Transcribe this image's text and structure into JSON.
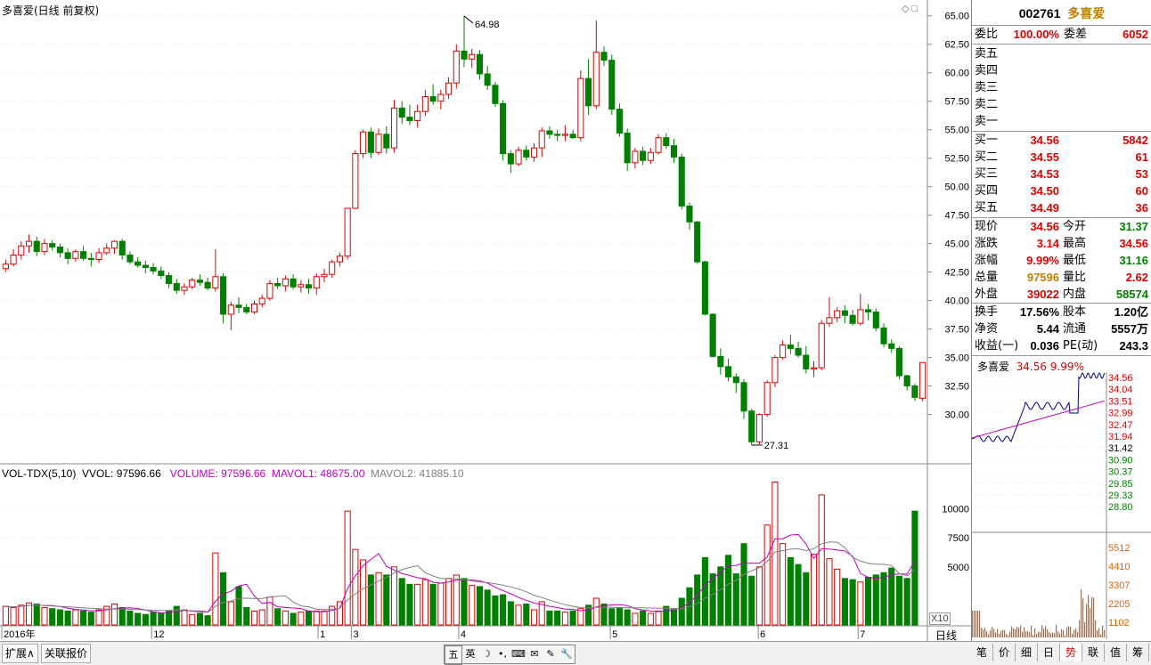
{
  "chart_title": "多喜爱(日线 前复权)",
  "price_axis_labels": [
    "65.00",
    "62.50",
    "60.00",
    "57.50",
    "55.00",
    "52.50",
    "50.00",
    "47.50",
    "45.00",
    "42.50",
    "40.00",
    "37.50",
    "35.00",
    "32.50",
    "30.00"
  ],
  "high_marker": "64.98",
  "low_marker": "27.31",
  "volume_legend": {
    "name": "VOL-TDX(5,10)",
    "vvol": "VVOL: 97596.66",
    "volume": "VOLUME: 97596.66",
    "mavol1": "MAVOL1: 48675.00",
    "mavol2": "MAVOL2: 41885.10"
  },
  "volume_axis_labels": [
    "10000",
    "7500",
    "5000"
  ],
  "volume_unit": "X10",
  "date_axis_labels": [
    "2016年",
    "12",
    "1",
    "3",
    "4",
    "5",
    "6",
    "7"
  ],
  "period_label": "日线",
  "bottom_tabs": [
    "扩展∧",
    "关联报价"
  ],
  "toolbar_icons": [
    "五",
    "英",
    "☽",
    "•,",
    "⌨",
    "✉",
    "✎",
    "🔧"
  ],
  "quote": {
    "code": "002761",
    "name": "多喜爱",
    "weibi_label": "委比",
    "weibi_value": "100.00%",
    "weicha_label": "委差",
    "weicha_value": "6052",
    "sell": [
      {
        "label": "卖五",
        "price": "",
        "vol": ""
      },
      {
        "label": "卖四",
        "price": "",
        "vol": ""
      },
      {
        "label": "卖三",
        "price": "",
        "vol": ""
      },
      {
        "label": "卖二",
        "price": "",
        "vol": ""
      },
      {
        "label": "卖一",
        "price": "",
        "vol": ""
      }
    ],
    "buy": [
      {
        "label": "买一",
        "price": "34.56",
        "vol": "5842"
      },
      {
        "label": "买二",
        "price": "34.55",
        "vol": "61"
      },
      {
        "label": "买三",
        "price": "34.53",
        "vol": "53"
      },
      {
        "label": "买四",
        "price": "34.50",
        "vol": "60"
      },
      {
        "label": "买五",
        "price": "34.49",
        "vol": "36"
      }
    ],
    "stats": [
      {
        "l1": "现价",
        "v1": "34.56",
        "c1": "red",
        "l2": "今开",
        "v2": "31.37",
        "c2": "green"
      },
      {
        "l1": "涨跌",
        "v1": "3.14",
        "c1": "red",
        "l2": "最高",
        "v2": "34.56",
        "c2": "red"
      },
      {
        "l1": "涨幅",
        "v1": "9.99%",
        "c1": "red",
        "l2": "最低",
        "v2": "31.16",
        "c2": "green"
      },
      {
        "l1": "总量",
        "v1": "97596",
        "c1": "olive",
        "l2": "量比",
        "v2": "2.62",
        "c2": "red"
      },
      {
        "l1": "外盘",
        "v1": "39022",
        "c1": "red",
        "l2": "内盘",
        "v2": "58574",
        "c2": "green"
      }
    ],
    "fin": [
      {
        "l1": "换手",
        "v1": "17.56%",
        "l2": "股本",
        "v2": "1.20亿"
      },
      {
        "l1": "净资",
        "v1": "5.44",
        "l2": "流通",
        "v2": "5557万"
      },
      {
        "l1": "收益(一)",
        "v1": "0.036",
        "l2": "PE(动)",
        "v2": "243.3"
      }
    ],
    "mini_title": "多喜爱",
    "mini_price": "34.56",
    "mini_pct": "9.99%",
    "mini_price_axis": [
      "34.56",
      "34.04",
      "33.51",
      "32.99",
      "32.47",
      "31.94",
      "31.42",
      "30.90",
      "30.37",
      "29.85",
      "29.33",
      "28.80"
    ],
    "mini_vol_axis": [
      "5512",
      "4410",
      "3307",
      "2205",
      "1102"
    ]
  },
  "right_tabs": [
    "笔",
    "价",
    "细",
    "日",
    "势",
    "联",
    "值",
    "筹"
  ],
  "colors": {
    "up": "#e00000",
    "down": "#008000",
    "ma1": "#c000c0",
    "ma2": "#808080"
  },
  "chart_data": {
    "type": "candlestick",
    "candles": [
      [
        42.8,
        43.6,
        42.5,
        43.2
      ],
      [
        43.2,
        44.5,
        43.0,
        44.0
      ],
      [
        44.0,
        45.2,
        43.6,
        44.8
      ],
      [
        44.8,
        45.8,
        44.2,
        45.2
      ],
      [
        45.2,
        45.6,
        43.9,
        44.3
      ],
      [
        44.3,
        45.4,
        44.0,
        45.0
      ],
      [
        45.0,
        45.3,
        44.4,
        44.7
      ],
      [
        44.7,
        45.0,
        43.8,
        44.2
      ],
      [
        44.2,
        44.6,
        43.2,
        43.7
      ],
      [
        43.7,
        44.5,
        43.4,
        44.3
      ],
      [
        44.3,
        44.8,
        43.5,
        43.7
      ],
      [
        43.7,
        44.2,
        43.0,
        43.6
      ],
      [
        43.6,
        44.6,
        43.3,
        44.2
      ],
      [
        44.2,
        45.0,
        44.0,
        44.6
      ],
      [
        44.6,
        45.3,
        44.1,
        45.2
      ],
      [
        45.2,
        45.4,
        43.6,
        44.0
      ],
      [
        44.0,
        44.3,
        43.2,
        43.4
      ],
      [
        43.4,
        43.8,
        42.9,
        43.1
      ],
      [
        43.1,
        43.5,
        42.4,
        42.9
      ],
      [
        42.9,
        43.3,
        42.3,
        42.6
      ],
      [
        42.6,
        43.0,
        41.9,
        42.2
      ],
      [
        42.2,
        42.5,
        41.1,
        41.5
      ],
      [
        41.5,
        41.9,
        40.6,
        40.9
      ],
      [
        40.9,
        41.5,
        40.5,
        41.2
      ],
      [
        41.2,
        42.0,
        41.0,
        41.8
      ],
      [
        41.8,
        42.3,
        41.3,
        41.6
      ],
      [
        41.6,
        42.0,
        40.9,
        41.1
      ],
      [
        41.1,
        44.5,
        40.8,
        42.1
      ],
      [
        42.1,
        42.4,
        38.0,
        38.8
      ],
      [
        38.8,
        39.9,
        37.4,
        39.6
      ],
      [
        39.6,
        40.3,
        38.9,
        39.4
      ],
      [
        39.4,
        39.7,
        38.8,
        39.0
      ],
      [
        39.0,
        40.0,
        38.8,
        39.7
      ],
      [
        39.7,
        40.5,
        39.4,
        40.2
      ],
      [
        40.2,
        41.8,
        40.0,
        41.5
      ],
      [
        41.5,
        42.0,
        41.0,
        41.3
      ],
      [
        41.3,
        42.2,
        40.8,
        41.9
      ],
      [
        41.9,
        42.3,
        41.0,
        41.2
      ],
      [
        41.2,
        41.8,
        40.7,
        41.4
      ],
      [
        41.4,
        41.9,
        40.6,
        41.1
      ],
      [
        41.1,
        42.4,
        40.5,
        42.1
      ],
      [
        42.1,
        42.8,
        41.6,
        42.3
      ],
      [
        42.3,
        43.6,
        42.0,
        43.4
      ],
      [
        43.4,
        44.2,
        43.0,
        43.9
      ],
      [
        43.9,
        48.1,
        43.6,
        48.1
      ],
      [
        48.1,
        53.2,
        48.0,
        52.9
      ],
      [
        52.9,
        55.0,
        52.5,
        54.8
      ],
      [
        54.8,
        55.2,
        52.5,
        53.0
      ],
      [
        53.0,
        55.1,
        52.8,
        54.6
      ],
      [
        54.6,
        55.3,
        52.9,
        53.4
      ],
      [
        53.4,
        57.6,
        53.0,
        56.9
      ],
      [
        56.9,
        57.5,
        55.5,
        56.1
      ],
      [
        56.1,
        57.2,
        55.4,
        55.8
      ],
      [
        55.8,
        57.2,
        55.2,
        56.6
      ],
      [
        56.6,
        58.5,
        56.2,
        57.9
      ],
      [
        57.9,
        59.0,
        57.2,
        57.5
      ],
      [
        57.5,
        58.5,
        56.8,
        58.1
      ],
      [
        58.1,
        59.6,
        57.7,
        59.1
      ],
      [
        59.1,
        62.5,
        58.6,
        61.9
      ],
      [
        61.9,
        64.98,
        60.5,
        61.2
      ],
      [
        61.2,
        62.1,
        60.4,
        61.6
      ],
      [
        61.6,
        62.0,
        59.4,
        59.9
      ],
      [
        59.9,
        60.6,
        58.5,
        58.9
      ],
      [
        58.9,
        59.2,
        57.0,
        57.3
      ],
      [
        57.3,
        57.6,
        52.3,
        52.9
      ],
      [
        52.9,
        53.2,
        51.2,
        52.0
      ],
      [
        52.0,
        53.5,
        51.8,
        53.2
      ],
      [
        53.2,
        53.6,
        52.3,
        52.6
      ],
      [
        52.6,
        53.8,
        52.2,
        53.4
      ],
      [
        53.4,
        55.2,
        52.6,
        54.9
      ],
      [
        54.9,
        55.3,
        54.2,
        54.6
      ],
      [
        54.6,
        55.0,
        54.0,
        54.5
      ],
      [
        54.5,
        55.4,
        54.0,
        54.6
      ],
      [
        54.6,
        55.0,
        54.2,
        54.3
      ],
      [
        54.3,
        60.2,
        54.0,
        59.5
      ],
      [
        59.5,
        61.2,
        56.3,
        57.1
      ],
      [
        57.1,
        64.6,
        56.8,
        61.8
      ],
      [
        61.8,
        62.3,
        60.6,
        61.1
      ],
      [
        61.1,
        61.6,
        56.3,
        56.8
      ],
      [
        56.8,
        57.3,
        54.4,
        54.7
      ],
      [
        54.7,
        55.1,
        51.4,
        52.1
      ],
      [
        52.1,
        53.4,
        51.6,
        53.1
      ],
      [
        53.1,
        53.5,
        51.9,
        52.3
      ],
      [
        52.3,
        53.4,
        52.0,
        53.0
      ],
      [
        53.0,
        54.6,
        52.8,
        54.3
      ],
      [
        54.3,
        54.7,
        53.3,
        53.6
      ],
      [
        53.6,
        54.2,
        52.1,
        52.6
      ],
      [
        52.6,
        52.9,
        48.0,
        48.3
      ],
      [
        48.3,
        48.6,
        46.2,
        46.9
      ],
      [
        46.9,
        47.0,
        43.2,
        43.4
      ],
      [
        43.4,
        43.5,
        38.7,
        38.8
      ],
      [
        38.8,
        38.9,
        35.0,
        35.1
      ],
      [
        35.1,
        35.8,
        33.5,
        34.2
      ],
      [
        34.2,
        34.9,
        32.9,
        33.3
      ],
      [
        33.3,
        33.6,
        31.9,
        32.8
      ],
      [
        32.8,
        33.1,
        29.6,
        30.3
      ],
      [
        30.3,
        30.5,
        27.31,
        27.6
      ],
      [
        27.6,
        30.1,
        27.4,
        30.0
      ],
      [
        30.0,
        33.0,
        29.8,
        32.8
      ],
      [
        32.8,
        35.2,
        32.4,
        35.0
      ],
      [
        35.0,
        36.5,
        34.8,
        36.1
      ],
      [
        36.1,
        37.0,
        35.3,
        35.8
      ],
      [
        35.8,
        36.4,
        35.0,
        35.2
      ],
      [
        35.2,
        36.0,
        33.6,
        34.0
      ],
      [
        34.0,
        34.7,
        33.3,
        34.1
      ],
      [
        34.1,
        38.3,
        33.9,
        38.0
      ],
      [
        38.0,
        40.3,
        37.7,
        38.5
      ],
      [
        38.5,
        39.4,
        38.1,
        39.1
      ],
      [
        39.1,
        39.6,
        38.0,
        38.7
      ],
      [
        38.7,
        39.2,
        37.8,
        38.0
      ],
      [
        38.0,
        40.6,
        37.8,
        39.2
      ],
      [
        39.2,
        39.7,
        38.3,
        39.0
      ],
      [
        39.0,
        39.3,
        37.3,
        37.6
      ],
      [
        37.6,
        38.0,
        35.9,
        36.2
      ],
      [
        36.2,
        36.6,
        35.4,
        35.8
      ],
      [
        35.8,
        36.0,
        33.1,
        33.4
      ],
      [
        33.4,
        33.5,
        32.1,
        32.5
      ],
      [
        32.5,
        32.7,
        31.2,
        31.5
      ],
      [
        31.42,
        34.56,
        31.16,
        34.56
      ]
    ],
    "volumes": [
      1600,
      1500,
      1700,
      1900,
      1800,
      1500,
      1400,
      1300,
      1200,
      1300,
      1200,
      1100,
      1300,
      1600,
      1800,
      1500,
      1200,
      1000,
      900,
      1100,
      1000,
      1200,
      1600,
      1300,
      900,
      1000,
      800,
      6200,
      4500,
      2000,
      3300,
      1500,
      1200,
      1300,
      2400,
      1400,
      1200,
      1000,
      1100,
      1200,
      1200,
      1200,
      1600,
      2000,
      9800,
      6500,
      5600,
      4300,
      4500,
      4300,
      5000,
      4000,
      3500,
      3500,
      3900,
      3500,
      3600,
      4000,
      4300,
      4000,
      3400,
      3300,
      3000,
      2500,
      2600,
      2000,
      1700,
      1800,
      1300,
      2000,
      1200,
      1200,
      1100,
      1200,
      1400,
      1700,
      2300,
      1800,
      1400,
      1500,
      1300,
      1000,
      1200,
      1000,
      1200,
      1600,
      1400,
      2300,
      3200,
      4300,
      5800,
      4400,
      5000,
      6000,
      4400,
      7000,
      4200,
      5000,
      8600,
      12300,
      7000,
      5800,
      5200,
      4500,
      6100,
      11200,
      5700,
      4800,
      4000,
      3900,
      3700,
      4100,
      4300,
      4500,
      4900,
      4200,
      4000,
      9800
    ]
  }
}
